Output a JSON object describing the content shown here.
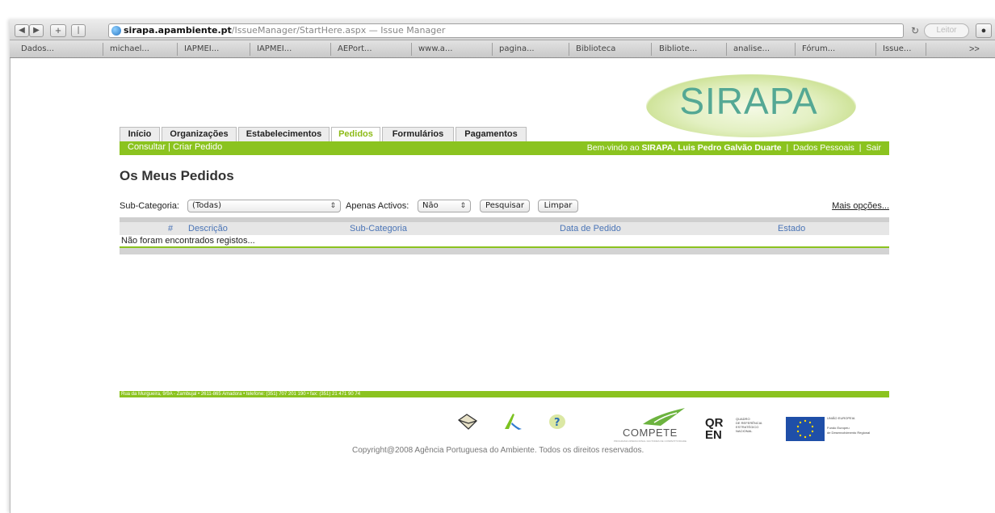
{
  "browser": {
    "address": {
      "host": "sirapa.apambiente.pt",
      "path": "/IssueManager/StartHere.aspx",
      "title_sep": " — ",
      "page_title": "Issue Manager"
    },
    "reader_label": "Leitor",
    "bookmarks": [
      "Dados...",
      "michael...",
      "IAPMEI...",
      "IAPMEI...",
      "AEPort...",
      "www.a...",
      "pagina...",
      "Biblioteca",
      "Bibliote...",
      "analise...",
      "Fórum...",
      "Issue..."
    ],
    "bookmarks_more": ">>"
  },
  "site": {
    "logo": "SIRAPA",
    "tabs": [
      "Início",
      "Organizações",
      "Estabelecimentos",
      "Pedidos",
      "Formulários",
      "Pagamentos"
    ],
    "active_tab": "Pedidos",
    "sub_links": [
      "Consultar",
      "Criar Pedido"
    ],
    "sub_sep": "|",
    "welcome_prefix": "Bem-vindo ao",
    "welcome_user": "SIRAPA, Luis Pedro Galvão Duarte",
    "user_links": [
      "Dados Pessoais",
      "Sair"
    ],
    "link_sep": "|"
  },
  "main": {
    "title": "Os Meus Pedidos",
    "filters": {
      "subcategory_label": "Sub-Categoria:",
      "subcategory_value": "(Todas)",
      "active_label": "Apenas Activos:",
      "active_value": "Não",
      "search_button": "Pesquisar",
      "clear_button": "Limpar",
      "more_options": "Mais opções..."
    },
    "table": {
      "columns": [
        "#",
        "Descrição",
        "Sub-Categoria",
        "Data de Pedido",
        "Estado"
      ],
      "empty_message": "Não foram encontrados registos..."
    }
  },
  "footer": {
    "address_line": "Rua da Murgueira, 9/9A - Zambujal • 2611-865 Amadora • telefone: (351) 707 201 190 • fax: (351) 21 471 90 74",
    "compete_label": "COMPETE",
    "compete_sub": "PROGRAMA OPERACIONAL FACTORES DE COMPETITIVIDADE",
    "qren_label": "QUADRO\nDE REFERÊNCIA\nESTRATÉGICO\nNACIONAL",
    "eu_label": "UNIÃO EUROPEIA\n\nFundo Europeu\nde Desenvolvimento Regional",
    "copyright": "Copyright@2008 Agência Portuguesa do Ambiente. Todos os direitos reservados."
  },
  "colors": {
    "brand_green": "#8bc31f",
    "logo_teal": "#54a894",
    "link_blue": "#4a74b6"
  }
}
